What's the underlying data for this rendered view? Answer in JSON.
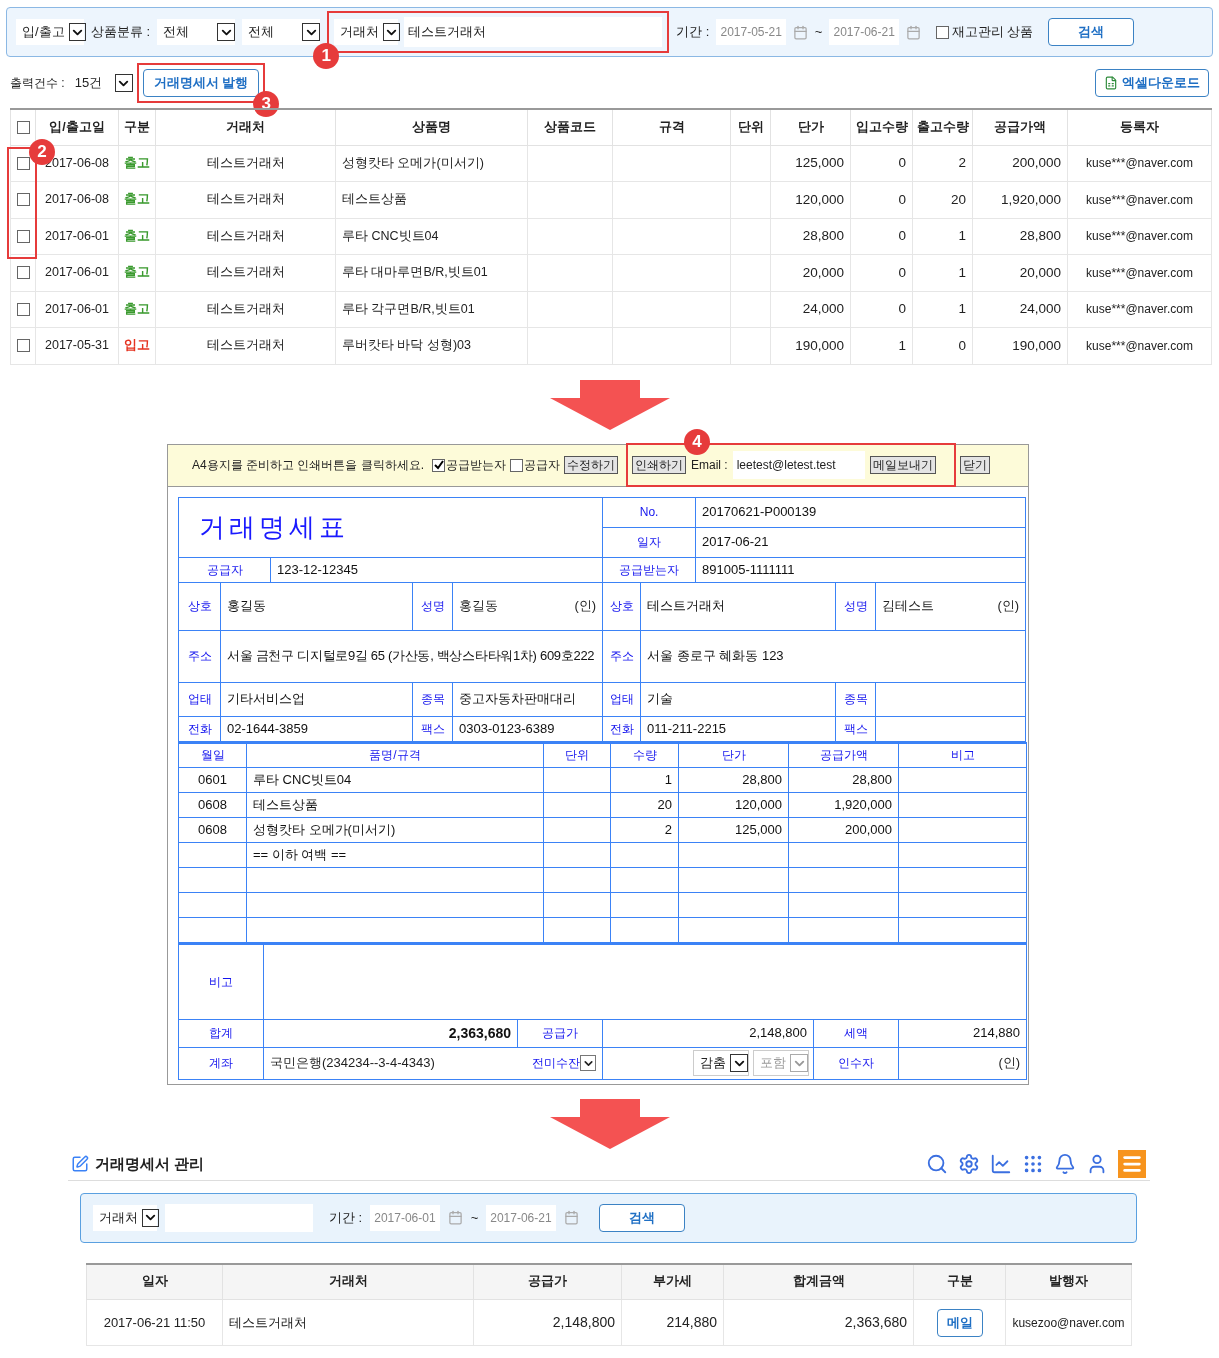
{
  "search_bar": {
    "io_select": "입/출고",
    "category_label": "상품분류 :",
    "category_main": "전체",
    "category_sub": "전체",
    "partner_select": "거래처",
    "partner_value": "테스트거래처",
    "period_label": "기간 :",
    "date_from": "2017-05-21",
    "tilde": "~",
    "date_to": "2017-06-21",
    "stock_only": {
      "label": "재고관리 상품",
      "checked": false
    },
    "search_button": "검색"
  },
  "toolbar": {
    "count_label": "출력건수 :",
    "count_select": "15건",
    "issue_button": "거래명세서 발행",
    "excel_button": "엑셀다운로드"
  },
  "callouts": [
    "1",
    "2",
    "3",
    "4"
  ],
  "list_table": {
    "header_checked": false,
    "columns": [
      "입/출고일",
      "구분",
      "거래처",
      "상품명",
      "상품코드",
      "규격",
      "단위",
      "단가",
      "입고수량",
      "출고수량",
      "공급가액",
      "등록자"
    ],
    "rows": [
      {
        "checked": false,
        "date": "2017-06-08",
        "type": "출고",
        "color": "#3a9a2e",
        "partner": "테스트거래처",
        "product": "성형캇타 오메가(미서기)",
        "price": "125,000",
        "in_qty": "0",
        "out_qty": "2",
        "amount": "200,000",
        "registrant": "kuse***@naver.com"
      },
      {
        "checked": false,
        "date": "2017-06-08",
        "type": "출고",
        "color": "#3a9a2e",
        "partner": "테스트거래처",
        "product": "테스트상품",
        "price": "120,000",
        "in_qty": "0",
        "out_qty": "20",
        "amount": "1,920,000",
        "registrant": "kuse***@naver.com"
      },
      {
        "checked": false,
        "date": "2017-06-01",
        "type": "출고",
        "color": "#3a9a2e",
        "partner": "테스트거래처",
        "product": "루타 CNC빗트04",
        "price": "28,800",
        "in_qty": "0",
        "out_qty": "1",
        "amount": "28,800",
        "registrant": "kuse***@naver.com"
      },
      {
        "checked": false,
        "date": "2017-06-01",
        "type": "출고",
        "color": "#3a9a2e",
        "partner": "테스트거래처",
        "product": "루타 대마루면B/R,빗트01",
        "price": "20,000",
        "in_qty": "0",
        "out_qty": "1",
        "amount": "20,000",
        "registrant": "kuse***@naver.com"
      },
      {
        "checked": false,
        "date": "2017-06-01",
        "type": "출고",
        "color": "#3a9a2e",
        "partner": "테스트거래처",
        "product": "루타 각구면B/R,빗트01",
        "price": "24,000",
        "in_qty": "0",
        "out_qty": "1",
        "amount": "24,000",
        "registrant": "kuse***@naver.com"
      },
      {
        "checked": false,
        "date": "2017-05-31",
        "type": "입고",
        "color": "#e5321f",
        "partner": "테스트거래처",
        "product": "루버캇타 바닥 성형)03",
        "price": "190,000",
        "in_qty": "1",
        "out_qty": "0",
        "amount": "190,000",
        "registrant": "kuse***@naver.com"
      }
    ]
  },
  "invoice": {
    "toolbar": {
      "instruction": "A4용지를 준비하고 인쇄버튼을 클릭하세요.",
      "copies": [
        {
          "label": "공급받는자",
          "checked": true
        },
        {
          "label": "공급자",
          "checked": false
        }
      ],
      "edit_button": "수정하기",
      "print_button": "인쇄하기",
      "email_label": "Email :",
      "email_value": "leetest@letest.test",
      "send_button": "메일보내기",
      "close_button": "닫기"
    },
    "title": "거래명세표",
    "no_label": "No.",
    "no_value": "20170621-P000139",
    "date_label": "일자",
    "date_value": "2017-06-21",
    "supplier_label": "공급자",
    "supplier_reg": "123-12-12345",
    "receiver_label": "공급받는자",
    "receiver_reg": "891005-1111111",
    "supplier": {
      "name_label": "상호",
      "name": "홍길동",
      "rep_label": "성명",
      "rep": "홍길동",
      "seal": "(인)",
      "address_label": "주소",
      "address": "서울 금천구 디지털로9길 65 (가산동, 백상스타타워1차) 609호222",
      "biz_label": "업태",
      "biz": "기타서비스업",
      "item_label": "종목",
      "item": "중고자동차판매대리",
      "phone_label": "전화",
      "phone": "02-1644-3859",
      "fax_label": "팩스",
      "fax": "0303-0123-6389"
    },
    "receiver": {
      "name_label": "상호",
      "name": "테스트거래처",
      "rep_label": "성명",
      "rep": "김테스트",
      "seal": "(인)",
      "address_label": "주소",
      "address": "서울 종로구 혜화동 123",
      "biz_label": "업태",
      "biz": "기술",
      "item_label": "종목",
      "phone_label": "전화",
      "phone": "011-211-2215",
      "fax_label": "팩스"
    },
    "lines": {
      "columns": [
        "월일",
        "품명/규격",
        "단위",
        "수량",
        "단가",
        "공급가액",
        "비고"
      ],
      "rows": [
        {
          "date": "0601",
          "name": "루타 CNC빗트04",
          "qty": "1",
          "price": "28,800",
          "amount": "28,800"
        },
        {
          "date": "0608",
          "name": "테스트상품",
          "qty": "20",
          "price": "120,000",
          "amount": "1,920,000"
        },
        {
          "date": "0608",
          "name": "성형캇타 오메가(미서기)",
          "qty": "2",
          "price": "125,000",
          "amount": "200,000"
        },
        {
          "name": "== 이하 여백 =="
        }
      ]
    },
    "footer": {
      "remark_label": "비고",
      "total_label": "합계",
      "total": "2,363,680",
      "supply_label": "공급가",
      "supply": "2,148,800",
      "tax_label": "세액",
      "tax": "214,880",
      "account_label": "계좌",
      "account": "국민은행(234234--3-4-4343)",
      "balance_label": "전미수잔",
      "hide_select": {
        "label": "감춤",
        "disabled": false
      },
      "include_select": {
        "label": "포함",
        "disabled": true
      },
      "taker_label": "인수자",
      "seal": "(인)"
    }
  },
  "management": {
    "title": "거래명세서 관리",
    "search": {
      "partner_select": "거래처",
      "period_label": "기간 :",
      "date_from": "2017-06-01",
      "tilde": "~",
      "date_to": "2017-06-21",
      "search_button": "검색"
    },
    "table": {
      "columns": [
        "일자",
        "거래처",
        "공급가",
        "부가세",
        "합계금액",
        "구분",
        "발행자"
      ],
      "rows": [
        {
          "date": "2017-06-21 11:50",
          "partner": "테스트거래처",
          "supply": "2,148,800",
          "tax": "214,880",
          "total": "2,363,680",
          "type_button": "메일",
          "issuer": "kusezoo@naver.com"
        }
      ]
    }
  }
}
